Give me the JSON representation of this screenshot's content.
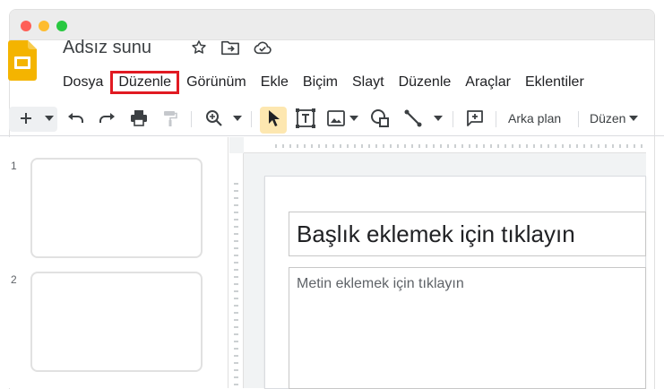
{
  "window": {
    "traffic_lights": [
      "close",
      "minimize",
      "zoom"
    ]
  },
  "header": {
    "title": "Adsız sunu",
    "icons": [
      "star-icon",
      "move-to-folder-icon",
      "cloud-saved-icon"
    ]
  },
  "menu": {
    "items": [
      {
        "label": "Dosya",
        "highlighted": false
      },
      {
        "label": "Düzenle",
        "highlighted": true
      },
      {
        "label": "Görünüm",
        "highlighted": false
      },
      {
        "label": "Ekle",
        "highlighted": false
      },
      {
        "label": "Biçim",
        "highlighted": false
      },
      {
        "label": "Slayt",
        "highlighted": false
      },
      {
        "label": "Düzenle",
        "highlighted": false
      },
      {
        "label": "Araçlar",
        "highlighted": false
      },
      {
        "label": "Eklentiler",
        "highlighted": false
      }
    ]
  },
  "toolbar": {
    "background_label": "Arka plan",
    "layout_label": "Düzen",
    "icons": [
      "add-icon",
      "undo-icon",
      "redo-icon",
      "print-icon",
      "paint-format-icon",
      "zoom-icon",
      "select-icon",
      "text-box-icon",
      "image-icon",
      "shape-icon",
      "line-icon",
      "comment-icon"
    ]
  },
  "filmstrip": {
    "slides": [
      {
        "number": "1"
      },
      {
        "number": "2"
      }
    ]
  },
  "slide": {
    "title_placeholder": "Başlık eklemek için tıklayın",
    "body_placeholder": "Metin eklemek için tıklayın"
  },
  "colors": {
    "highlight_box": "#e11a22",
    "slides_logo": "#f4b400",
    "selected_tool": "#fde7b0"
  }
}
